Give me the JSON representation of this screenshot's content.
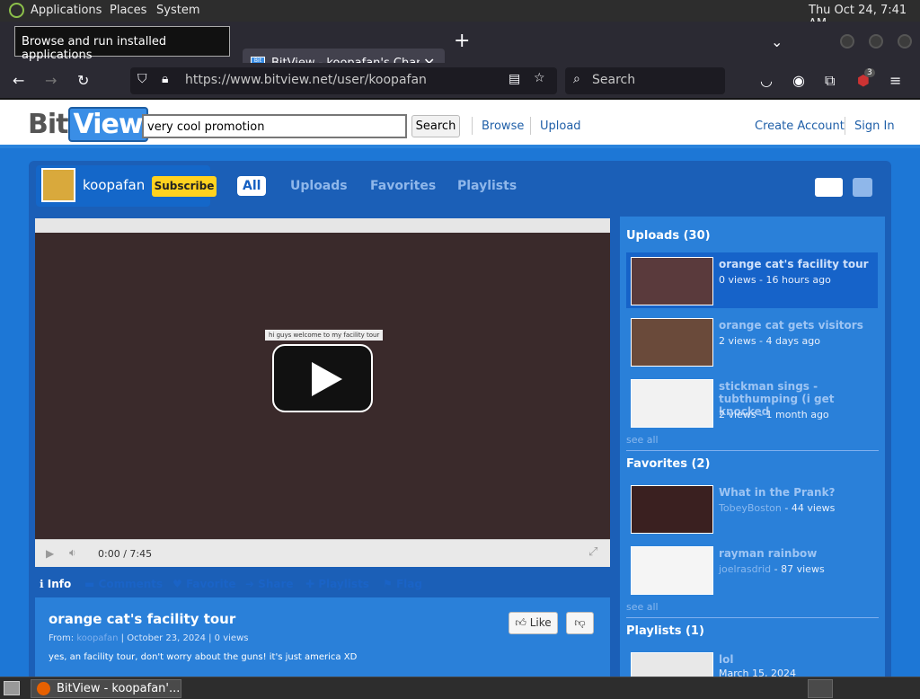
{
  "system_bar": {
    "applications": "Applications",
    "places": "Places",
    "system": "System",
    "clock": "Thu Oct 24,  7:41 AM"
  },
  "tooltip": "Browse and run installed applications",
  "browser": {
    "tab_title": "BitView - koopafan's Chann",
    "url": "https://www.bitview.net/user/koopafan",
    "search_placeholder": "Search",
    "extension_badge": "3"
  },
  "site": {
    "logo_bit": "Bit",
    "logo_view": "View",
    "search_value": "very cool promotion",
    "search_button": "Search",
    "nav": [
      "Browse",
      "Upload"
    ],
    "create_account": "Create Account",
    "sign_in": "Sign In"
  },
  "channel": {
    "name": "koopafan",
    "subscribe": "Subscribe",
    "tabs": [
      "All",
      "Uploads",
      "Favorites",
      "Playlists"
    ],
    "active_tab": "All"
  },
  "player": {
    "time": "0:00 / 7:45",
    "in_video_caption": "hi guys welcome to my facility tour"
  },
  "actions": [
    "Info",
    "Comments",
    "Favorite",
    "Share",
    "Playlists",
    "Flag"
  ],
  "video": {
    "title": "orange cat's facility tour",
    "from_label": "From:",
    "author": "koopafan",
    "date_views": "| October 23, 2024 | 0 views",
    "description": "yes, an facility tour, don't worry about the guns! it's just america XD",
    "like": "Like"
  },
  "sidebar": {
    "uploads_header": "Uploads (30)",
    "uploads": [
      {
        "title": "orange cat's facility tour",
        "meta": "0 views - 16 hours ago"
      },
      {
        "title": "orange cat gets visitors",
        "meta": "2 views - 4 days ago"
      },
      {
        "title": "stickman sings - tubthumping (i get knocked",
        "meta": "2 views - 1 month ago"
      }
    ],
    "see_all_1": "see all",
    "favorites_header": "Favorites (2)",
    "favorites": [
      {
        "title": "What in the Prank?",
        "author": "TobeyBoston",
        "views": " - 44 views"
      },
      {
        "title": "rayman rainbow",
        "author": "joelrasdrid",
        "views": " - 87 views"
      }
    ],
    "see_all_2": "see all",
    "playlists_header": "Playlists (1)",
    "playlists": [
      {
        "title": "lol",
        "date": "March 15, 2024"
      }
    ]
  },
  "taskbar": {
    "window": "BitView - koopafan'..."
  }
}
